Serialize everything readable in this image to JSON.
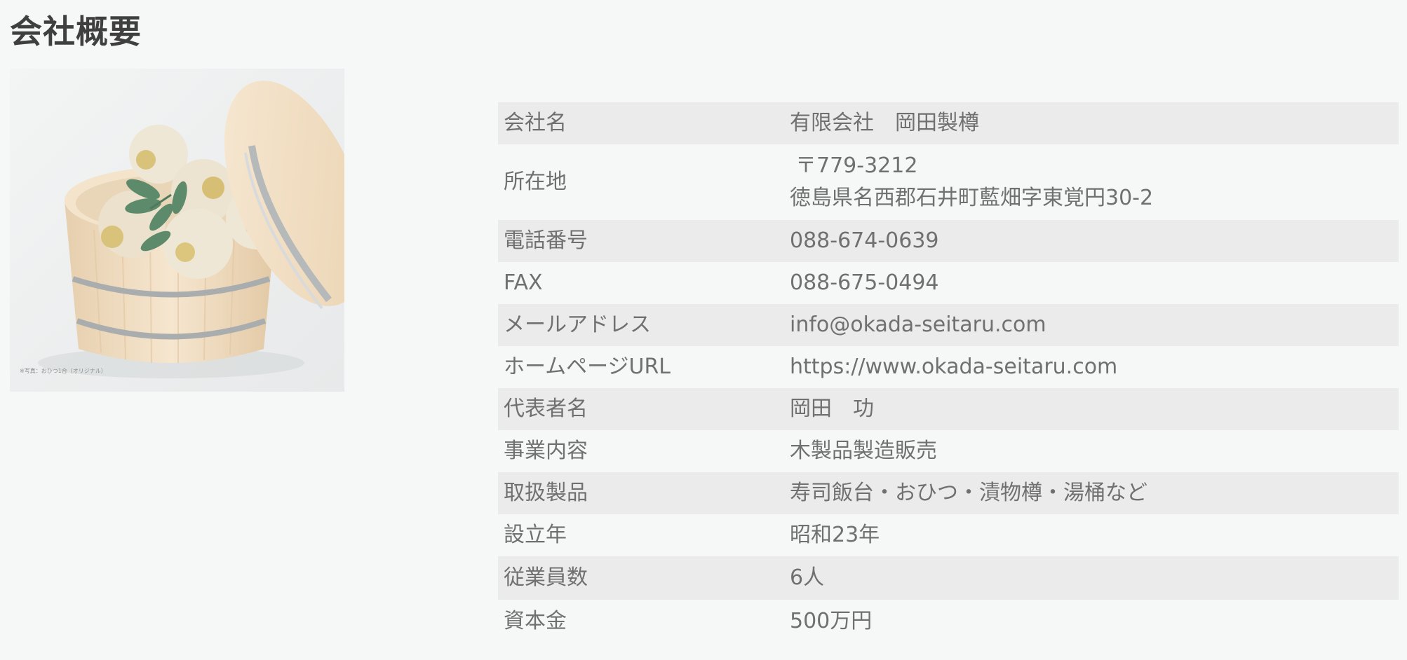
{
  "page": {
    "title": "会社概要"
  },
  "photo": {
    "caption": "※写真：おひつ1合（オリジナル）",
    "colors": {
      "background": "#eef0f0",
      "wood": "#f1dcbf",
      "wood_dark": "#e2c49c",
      "hoop": "#a9adae",
      "rice": "#efe7d6",
      "chestnut": "#d9c27a",
      "leaf": "#5c8a6a"
    }
  },
  "company_info": {
    "rows": [
      {
        "label": "会社名",
        "value": "有限会社　岡田製樽"
      },
      {
        "label": "所在地",
        "postal": "〒779-3212",
        "value": "徳島県名西郡石井町藍畑字東覚円30-2"
      },
      {
        "label": "電話番号",
        "value": "088-674-0639"
      },
      {
        "label": "FAX",
        "value": "088-675-0494"
      },
      {
        "label": "メールアドレス",
        "value": "info@okada-seitaru.com"
      },
      {
        "label": "ホームページURL",
        "value": "https://www.okada-seitaru.com"
      },
      {
        "label": "代表者名",
        "value": "岡田　功"
      },
      {
        "label": "事業内容",
        "value": "木製品製造販売"
      },
      {
        "label": "取扱製品",
        "value": "寿司飯台・おひつ・漬物樽・湯桶など"
      },
      {
        "label": "設立年",
        "value": "昭和23年"
      },
      {
        "label": "従業員数",
        "value": "6人"
      },
      {
        "label": "資本金",
        "value": "500万円"
      }
    ]
  },
  "colors": {
    "page_background": "#f6f7f7",
    "row_shade": "#ebebeb",
    "title_text": "#3f3f3f",
    "body_text": "#707070"
  }
}
